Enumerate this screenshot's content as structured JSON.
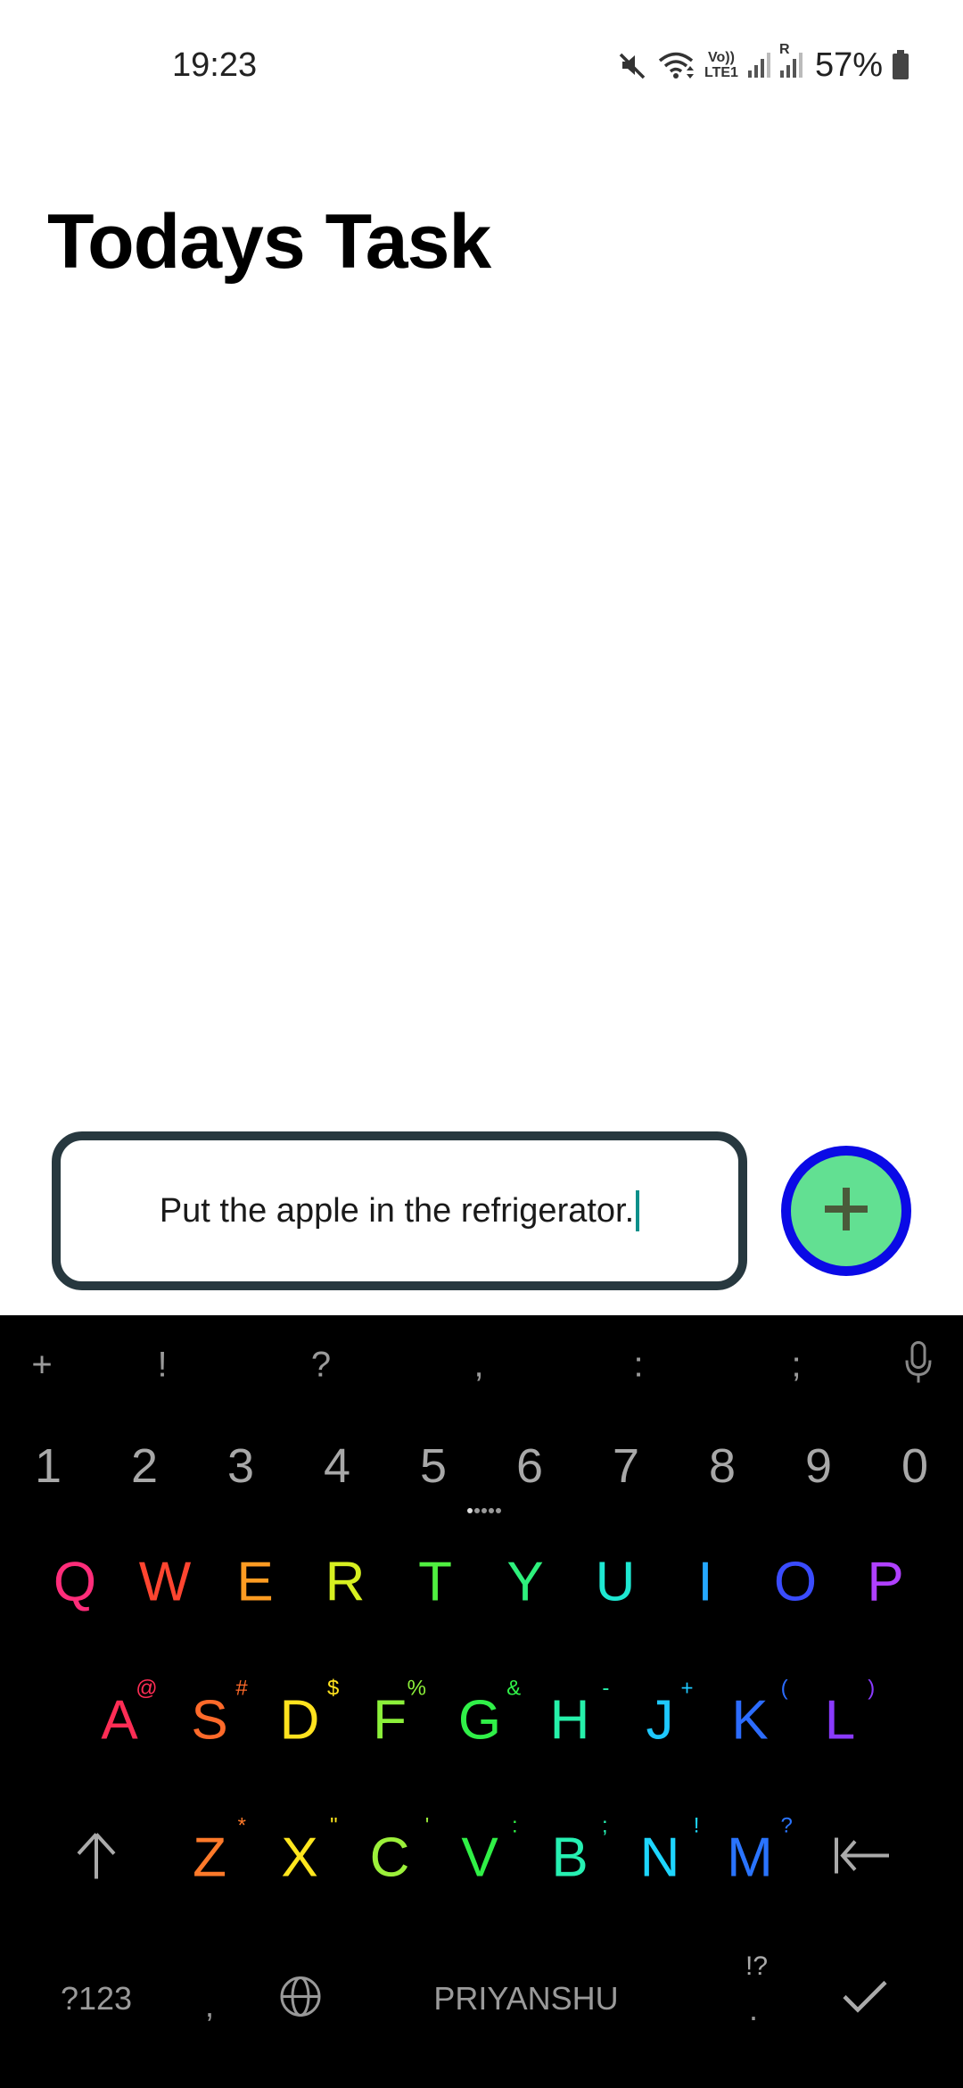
{
  "status_bar": {
    "time": "19:23",
    "volte_top": "Vo))",
    "volte_bottom": "LTE1",
    "roaming": "R",
    "battery": "57%",
    "icons": [
      "mute-icon",
      "wifi-icon",
      "signal-icon",
      "signal-roaming-icon",
      "battery-icon"
    ]
  },
  "page": {
    "title": "Todays Task"
  },
  "task_input": {
    "value": "Put the apple in the refrigerator."
  },
  "add_button": {
    "icon": "plus-icon",
    "fill": "#62e092",
    "ring": "#0a0ae6"
  },
  "keyboard": {
    "suggestion_row": [
      "+",
      "!",
      "?",
      ",",
      ":",
      ";"
    ],
    "numbers": [
      "1",
      "2",
      "3",
      "4",
      "5",
      "6",
      "7",
      "8",
      "9",
      "0"
    ],
    "row1": [
      "Q",
      "W",
      "E",
      "R",
      "T",
      "Y",
      "U",
      "I",
      "O",
      "P"
    ],
    "row2": [
      "A",
      "S",
      "D",
      "F",
      "G",
      "H",
      "J",
      "K",
      "L"
    ],
    "row2_alt": [
      "@",
      "#",
      "$",
      "%",
      "&",
      "-",
      "+",
      "(",
      ")"
    ],
    "row3": [
      "Z",
      "X",
      "C",
      "V",
      "B",
      "N",
      "M"
    ],
    "row3_alt": [
      "*",
      "\"",
      "'",
      ":",
      ";",
      "!",
      "?"
    ],
    "symbols_key": "?123",
    "comma_key": ",",
    "space_label": "PRIYANSHU",
    "period_key": ".",
    "period_alt": "!?",
    "colors": {
      "row1": [
        "#ff2d7a",
        "#ff4530",
        "#ff9c22",
        "#d7f020",
        "#50f040",
        "#2ef07c",
        "#1ee8d2",
        "#25a8ff",
        "#3a4cff",
        "#b040ff"
      ],
      "row2": [
        "#ff2d55",
        "#ff6a2a",
        "#ffe21e",
        "#8cf03a",
        "#30f048",
        "#26f0aa",
        "#1ec8ff",
        "#2c6cff",
        "#8a3aff"
      ],
      "row3": [
        "#ff7a2a",
        "#ffe61e",
        "#9cf03a",
        "#30f046",
        "#26f0b2",
        "#1ed6ff",
        "#2a74ff"
      ]
    }
  }
}
